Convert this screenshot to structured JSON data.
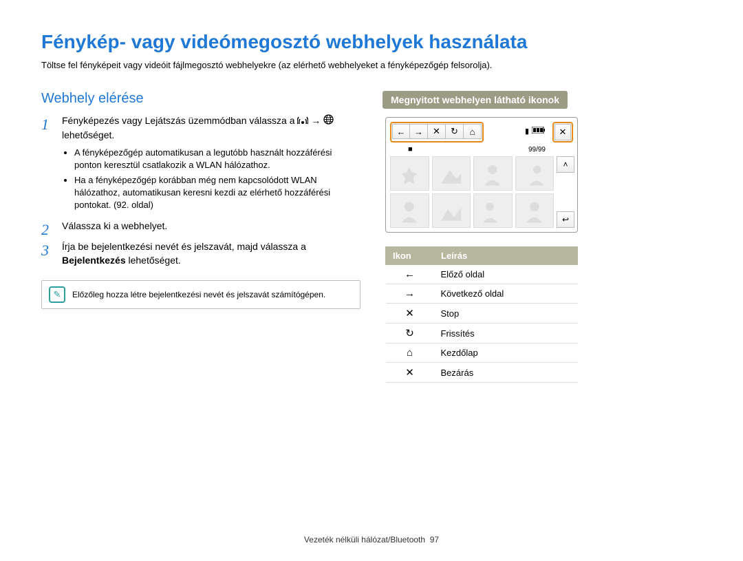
{
  "title": "Fénykép- vagy videómegosztó webhelyek használata",
  "intro": "Töltse fel fényképeit vagy videóit fájlmegosztó webhelyekre (az elérhető webhelyeket a fényképezőgép felsorolja).",
  "left": {
    "section_title": "Webhely elérése",
    "step1_part1": "Fényképezés vagy Lejátszás üzemmódban válassza a ",
    "step1_arrow": " → ",
    "step1_part2": " lehetőséget.",
    "step1_bullets": [
      "A fényképezőgép automatikusan a legutóbb használt hozzáférési ponton keresztül csatlakozik a WLAN hálózathoz.",
      "Ha a fényképezőgép korábban még nem kapcsolódott WLAN hálózathoz, automatikusan keresni kezdi az elérhető hozzáférési pontokat. (92. oldal)"
    ],
    "step2": "Válassza ki a webhelyet.",
    "step3_part1": "Írja be bejelentkezési nevét és jelszavát, majd válassza a ",
    "step3_bold": "Bejelentkezés",
    "step3_part2": " lehetőséget.",
    "note": "Előzőleg hozza létre bejelentkezési nevét és jelszavát számítógépen."
  },
  "right": {
    "callout": "Megnyitott webhelyen látható ikonok",
    "counter": "99/99",
    "table_headers": {
      "icon": "Ikon",
      "desc": "Leírás"
    },
    "rows": [
      {
        "icon": "←",
        "desc": "Előző oldal"
      },
      {
        "icon": "→",
        "desc": "Következő oldal"
      },
      {
        "icon": "✕",
        "desc": "Stop"
      },
      {
        "icon": "↻",
        "desc": "Frissítés"
      },
      {
        "icon": "⌂",
        "desc": "Kezdőlap"
      },
      {
        "icon": "✕",
        "desc": "Bezárás"
      }
    ]
  },
  "footer": {
    "text": "Vezeték nélküli hálózat/Bluetooth",
    "page": "97"
  }
}
